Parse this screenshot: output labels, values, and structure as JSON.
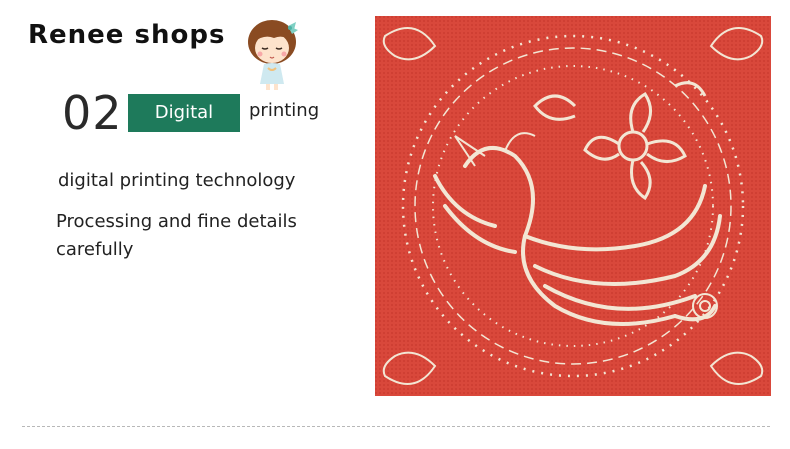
{
  "brand": {
    "name": "Renee shops"
  },
  "mascot": {
    "icon": "cartoon-girl-icon"
  },
  "step": {
    "number": "02",
    "badge_label": "Digital",
    "badge_suffix": "printing",
    "badge_color": "#1e7a5b"
  },
  "description": {
    "line1": "digital printing technology",
    "line2": "Processing and fine details carefully"
  },
  "product_image": {
    "icon": "phoenix-pattern-pillow-image",
    "background_color": "#d9483b",
    "pattern_color": "#f3e6d4"
  }
}
